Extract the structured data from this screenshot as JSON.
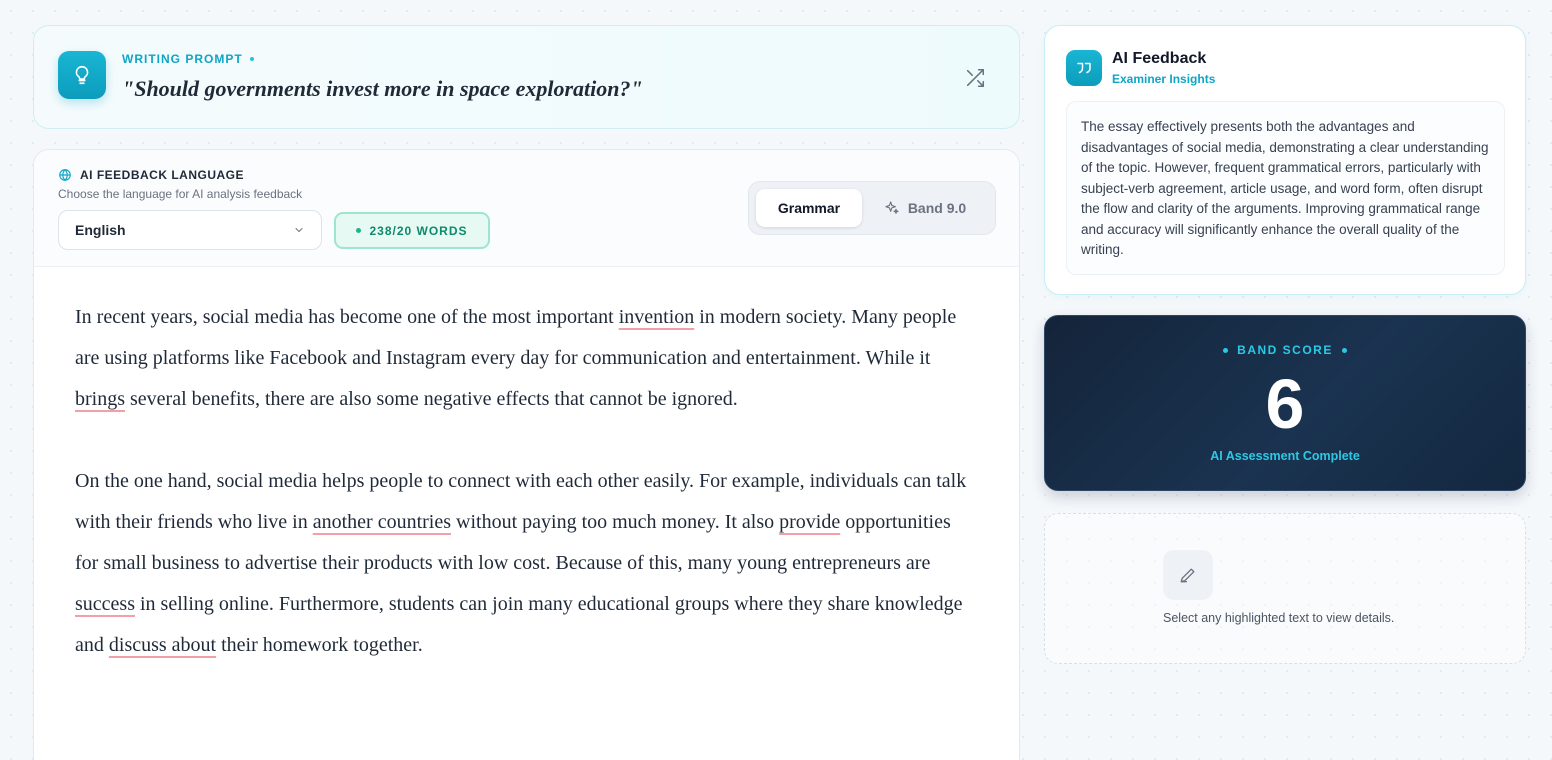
{
  "prompt": {
    "label": "WRITING PROMPT",
    "text": "\"Should governments invest more in space exploration?\""
  },
  "language": {
    "title": "AI FEEDBACK LANGUAGE",
    "subtitle": "Choose the language for AI analysis feedback",
    "selected": "English"
  },
  "word_count": "238/20 WORDS",
  "modes": {
    "grammar": "Grammar",
    "band": "Band 9.0"
  },
  "essay": {
    "p1": {
      "s1": "In recent years, social media has become one of the most important ",
      "e1": "invention",
      "s2": " in modern society. Many people are using platforms like Facebook and Instagram every day for communication and entertainment. While it ",
      "e2": "brings",
      "s3": " several benefits, there are also some negative effects that cannot be ignored."
    },
    "p2": {
      "s1": "On the one hand, social media helps people to connect with each other easily. For example, individuals can talk with their friends who live in ",
      "e1": "another countries",
      "s2": " without paying too much money. It also ",
      "e2": "provide",
      "s3": " opportunities for small business to advertise their products with low cost. Because of this, many young entrepreneurs are ",
      "e3": "success",
      "s4": " in selling online. Furthermore, students can join many educational groups where they share knowledge and ",
      "e4": "discuss about",
      "s5": " their homework together."
    }
  },
  "feedback": {
    "title": "AI Feedback",
    "subtitle": "Examiner Insights",
    "text": "The essay effectively presents both the advantages and disadvantages of social media, demonstrating a clear understanding of the topic. However, frequent grammatical errors, particularly with subject-verb agreement, article usage, and word form, often disrupt the flow and clarity of the arguments. Improving grammatical range and accuracy will significantly enhance the overall quality of the writing."
  },
  "band": {
    "label": "BAND SCORE",
    "value": "6",
    "status": "AI Assessment Complete"
  },
  "details": {
    "text": "Select any highlighted text to view details."
  },
  "colors": {
    "accent": "#0ea5c6",
    "error_underline": "#f2a0a8",
    "band_bg": "#14243a"
  },
  "icons": [
    "lightbulb-icon",
    "shuffle-icon",
    "globe-icon",
    "chevron-down-icon",
    "sparkles-icon",
    "quote-icon",
    "pencil-icon"
  ]
}
